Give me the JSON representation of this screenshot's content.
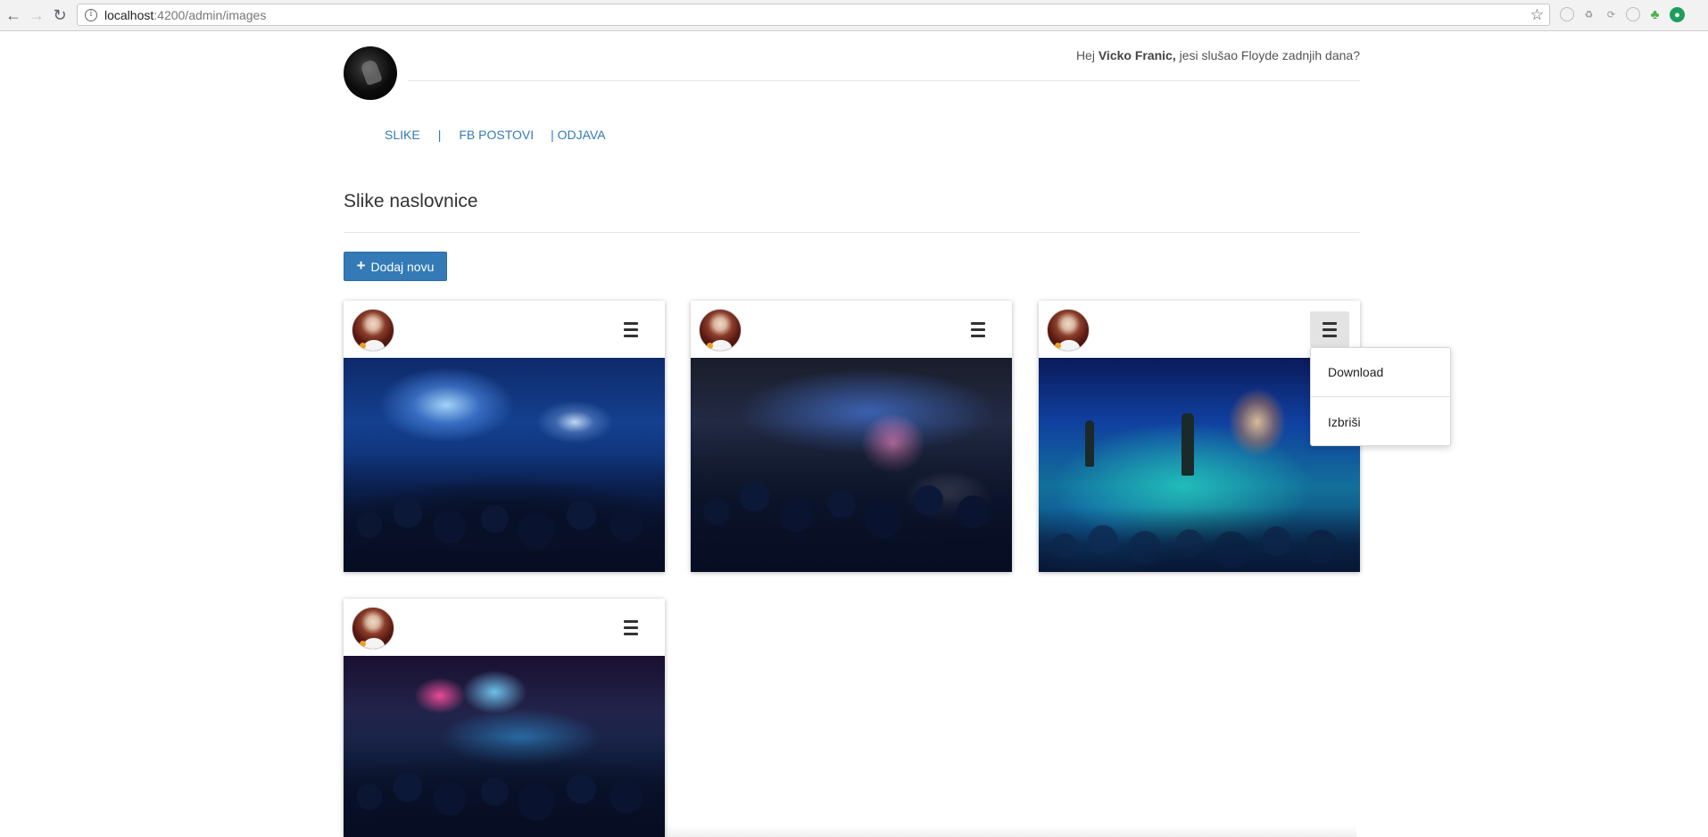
{
  "browser": {
    "url_host": "localhost",
    "url_path": ":4200/admin/images"
  },
  "header": {
    "greeting_prefix": "Hej ",
    "user_name": "Vicko Franic,",
    "greeting_suffix": " jesi slušao Floyde zadnjih dana?"
  },
  "nav": {
    "items": [
      {
        "label": "SLIKE"
      },
      {
        "label": "FB POSTOVI"
      },
      {
        "label": "| ODJAVA"
      }
    ],
    "separator": "|"
  },
  "page": {
    "title": "Slike naslovnice",
    "add_button_label": "Dodaj novu",
    "add_button_icon": "plus-icon"
  },
  "cards": [
    {
      "menu_icon": "hamburger-icon"
    },
    {
      "menu_icon": "hamburger-icon"
    },
    {
      "menu_icon": "hamburger-icon",
      "menu_open": true
    },
    {
      "menu_icon": "hamburger-icon"
    }
  ],
  "dropdown": {
    "items": [
      {
        "label": "Download"
      },
      {
        "label": "Izbriši"
      }
    ]
  },
  "colors": {
    "primary": "#337ab7",
    "link": "#337ab7"
  }
}
